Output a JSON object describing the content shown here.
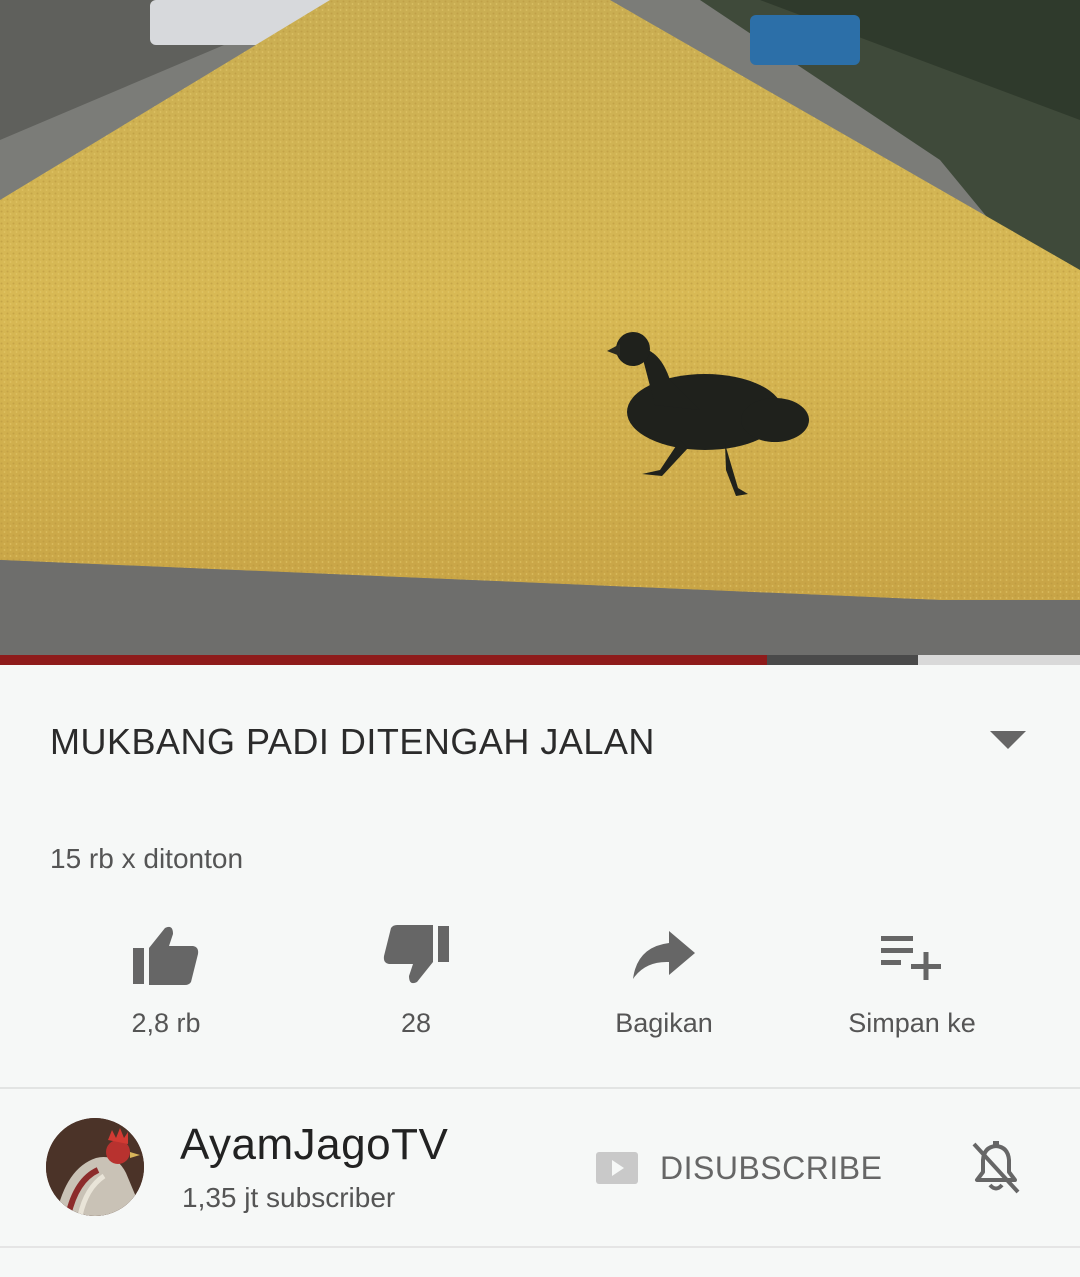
{
  "video": {
    "progress_played": 0.71,
    "progress_buffered_to": 0.85
  },
  "details": {
    "title": "MUKBANG PADI DITENGAH JALAN",
    "views": "15 rb x ditonton"
  },
  "actions": [
    {
      "label": "2,8 rb",
      "icon": "thumbs-up-icon"
    },
    {
      "label": "28",
      "icon": "thumbs-down-icon"
    },
    {
      "label": "Bagikan",
      "icon": "share-icon"
    },
    {
      "label": "Simpan ke",
      "icon": "playlist-add-icon"
    }
  ],
  "channel": {
    "name": "AyamJagoTV",
    "subscribers": "1,35 jt subscriber",
    "subscribe_label": "DISUBSCRIBE",
    "bell_icon": "bell-off-icon"
  },
  "colors": {
    "progress": "#8e1b1b",
    "icon": "#666666"
  }
}
